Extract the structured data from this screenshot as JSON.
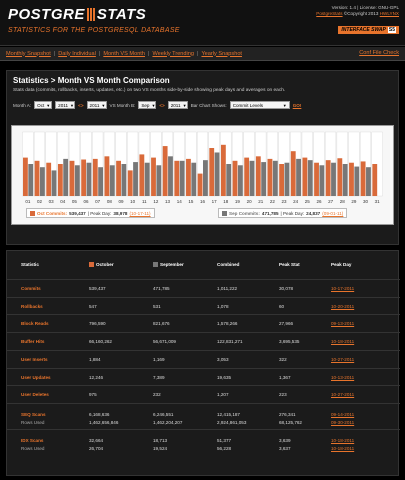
{
  "header": {
    "logo_left": "POSTGRE",
    "logo_right": "STATS",
    "tagline": "STATISTICS FOR THE POSTGRESQL DATABASE",
    "version_line": "Version: 1.4 | License: GNU-GPL",
    "copyright_link": "PostgreStats",
    "copyright_text": "©Copyright 2013",
    "copyright_author": "HWLYNX",
    "badge_text": "INTERFACE SWAP",
    "badge_box": "S5"
  },
  "nav": {
    "items": [
      "Monthly Snapshot",
      "Daily Individual",
      "Month VS Month",
      "Weekly Trending",
      "Yearly Snapshot"
    ],
    "conf_link": "Conf File Check"
  },
  "panel": {
    "title": "Statistics > Month VS Month Comparison",
    "description": "Stats data (commits, rollbacks, inserts, updates, etc.) on two VS months side-by-side showing peak days and averages on each.",
    "month_a_label": "Month A:",
    "month_a": "Oct",
    "year_a": "2011",
    "vs_arrows": "<>",
    "month_b_label": "VS Month B:",
    "month_b": "Sep",
    "year_b": "2011",
    "bar_chart_label": "Bar Chart Shows:",
    "bar_chart_value": "Commit Levels",
    "go_label": "GO!"
  },
  "chart_data": {
    "type": "bar",
    "categories": [
      "01",
      "02",
      "03",
      "04",
      "05",
      "06",
      "07",
      "08",
      "09",
      "10",
      "11",
      "12",
      "13",
      "14",
      "15",
      "16",
      "17",
      "18",
      "19",
      "20",
      "21",
      "22",
      "23",
      "24",
      "25",
      "26",
      "27",
      "28",
      "29",
      "30",
      "31"
    ],
    "series": [
      {
        "name": "Oct Commits",
        "color": "#d96a3a",
        "values": [
          0.6,
          0.55,
          0.52,
          0.5,
          0.55,
          0.57,
          0.58,
          0.62,
          0.55,
          0.4,
          0.65,
          0.6,
          0.78,
          0.55,
          0.58,
          0.35,
          0.75,
          0.8,
          0.55,
          0.6,
          0.62,
          0.58,
          0.5,
          0.7,
          0.6,
          0.52,
          0.56,
          0.59,
          0.52,
          0.54,
          0.5
        ]
      },
      {
        "name": "Sep Commits",
        "color": "#777777",
        "values": [
          0.5,
          0.45,
          0.4,
          0.58,
          0.48,
          0.52,
          0.45,
          0.48,
          0.5,
          0.53,
          0.52,
          0.48,
          0.62,
          0.55,
          0.52,
          0.56,
          0.68,
          0.5,
          0.48,
          0.55,
          0.53,
          0.55,
          0.52,
          0.58,
          0.56,
          0.48,
          0.52,
          0.5,
          0.46,
          0.45,
          0
        ]
      }
    ],
    "ylim": [
      0,
      1
    ]
  },
  "legend": {
    "a_label": "Oct Commits:",
    "a_total": "539,437",
    "a_peak_label": "| Peak Day:",
    "a_peak": "38,978",
    "a_peak_date": "(10-17-11)",
    "b_label": "Sep Commits:",
    "b_total": "471,785",
    "b_peak_label": "| Peak Day:",
    "b_peak": "24,837",
    "b_peak_date": "(09-01-11)"
  },
  "stats": {
    "headers": [
      "Statistic",
      "October",
      "September",
      "Combined",
      "Peak Stat",
      "Peak Day"
    ],
    "rows": [
      {
        "name": "Commits",
        "oct": "539,437",
        "sep": "471,785",
        "comb": "1,011,222",
        "peak": "30,078",
        "day": "10-17-2011"
      },
      {
        "name": "Rollbacks",
        "oct": "547",
        "sep": "531",
        "comb": "1,078",
        "peak": "60",
        "day": "10-20-2011"
      },
      {
        "name": "Block Reads",
        "oct": "796,590",
        "sep": "821,676",
        "comb": "1,578,266",
        "peak": "27,966",
        "day": "09-13-2011"
      },
      {
        "name": "Buffer Hits",
        "oct": "66,160,262",
        "sep": "56,671,009",
        "comb": "122,831,271",
        "peak": "3,695,535",
        "day": "10-18-2011"
      },
      {
        "name": "User Inserts",
        "oct": "1,884",
        "sep": "1,169",
        "comb": "3,053",
        "peak": "322",
        "day": "10-27-2011"
      },
      {
        "name": "User Updates",
        "oct": "12,246",
        "sep": "7,389",
        "comb": "19,635",
        "peak": "1,367",
        "day": "10-13-2011"
      },
      {
        "name": "User Deletes",
        "oct": "975",
        "sep": "232",
        "comb": "1,207",
        "peak": "223",
        "day": "10-27-2011"
      }
    ],
    "seq_scans": {
      "name": "SEQ Scans",
      "oct": "6,168,636",
      "sep": "6,246,551",
      "comb": "12,415,187",
      "peak": "276,341",
      "day": "09-14-2011"
    },
    "seq_rows": {
      "name": "Rows Used",
      "oct": "1,462,656,846",
      "sep": "1,462,204,207",
      "comb": "2,924,861,053",
      "peak": "68,125,762",
      "day": "09-30-2011"
    },
    "idx_scans": {
      "name": "IDX Scans",
      "oct": "32,664",
      "sep": "18,713",
      "comb": "51,377",
      "peak": "3,639",
      "day": "10-18-2011"
    },
    "idx_rows": {
      "name": "Rows Used",
      "oct": "26,704",
      "sep": "19,524",
      "comb": "56,228",
      "peak": "3,637",
      "day": "10-18-2011"
    }
  }
}
